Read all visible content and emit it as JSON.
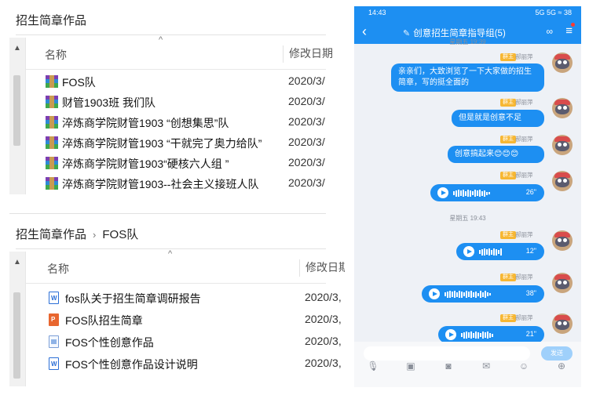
{
  "explorer_top": {
    "breadcrumb": "招生简章作品",
    "col_name": "名称",
    "col_date": "修改日期",
    "files": [
      {
        "name": "FOS队",
        "date": "2020/3/",
        "icon": "winrar-icon"
      },
      {
        "name": "财管1903班 我们队",
        "date": "2020/3/",
        "icon": "winrar-icon"
      },
      {
        "name": "淬炼商学院财管1903 “创想集思”队",
        "date": "2020/3/",
        "icon": "winrar-icon"
      },
      {
        "name": "淬炼商学院财管1903 “干就完了奥力给队”",
        "date": "2020/3/",
        "icon": "winrar-icon"
      },
      {
        "name": "淬炼商学院财管1903“硬核六人组 ”",
        "date": "2020/3/",
        "icon": "winrar-icon"
      },
      {
        "name": "淬炼商学院财管1903--社会主义接班人队",
        "date": "2020/3/",
        "icon": "winrar-icon"
      }
    ]
  },
  "explorer_bottom": {
    "breadcrumb_root": "招生简章作品",
    "breadcrumb_sep": "›",
    "breadcrumb_current": "FOS队",
    "col_name": "名称",
    "col_date": "修改日期",
    "files": [
      {
        "name": "fos队关于招生简章调研报告",
        "date": "2020/3,",
        "icon": "word-doc-icon",
        "glyph": "W"
      },
      {
        "name": "FOS队招生简章",
        "date": "2020/3,",
        "icon": "ppt-icon",
        "glyph": "P"
      },
      {
        "name": "FOS个性创意作品",
        "date": "2020/3,",
        "icon": "generic-file-icon",
        "glyph": ""
      },
      {
        "name": "FOS个性创意作品设计说明",
        "date": "2020/3,",
        "icon": "word-doc-icon",
        "glyph": "W"
      }
    ]
  },
  "phone": {
    "status_time": "14:43",
    "status_right": "5G 5G ≈ 38",
    "chat_title": "创意招生简章指导组(5)",
    "time_1": "星期五 19:39",
    "time_2": "星期五 19:43",
    "badge": "群主",
    "sender": "郝丽萍",
    "messages": [
      {
        "type": "text",
        "text": "亲亲们，大致浏览了一下大家做的招生简章，写的挺全面的"
      },
      {
        "type": "text",
        "text": "但是就是创意不足"
      },
      {
        "type": "text",
        "text": "创意搞起来😊😊😊"
      },
      {
        "type": "voice",
        "duration": "26\""
      },
      {
        "type": "voice",
        "duration": "12\""
      },
      {
        "type": "voice",
        "duration": "38\""
      },
      {
        "type": "voice",
        "duration": "21\""
      }
    ],
    "send_label": "发送"
  }
}
